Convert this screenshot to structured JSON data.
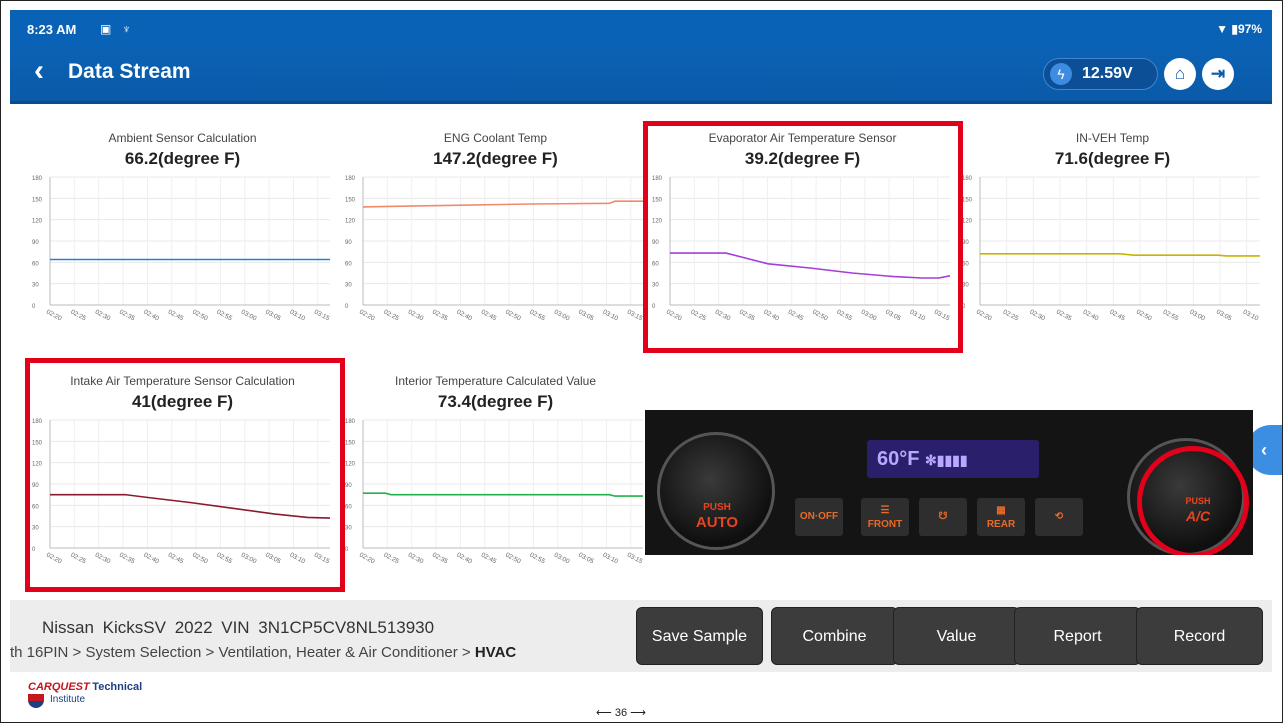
{
  "status": {
    "time": "8:23 AM",
    "battery": "97%"
  },
  "header": {
    "title": "Data Stream",
    "voltage": "12.59V"
  },
  "icons": {
    "back": "chevron-left-icon",
    "home": "home-icon",
    "exit": "exit-icon",
    "bolt": "lightning-icon"
  },
  "colors": {
    "header_blue": "#0a62b6",
    "highlight_red": "#e2001a",
    "ambient": "#2a7fd4",
    "coolant": "#f08a6a",
    "evaporator": "#a23fd8",
    "in_veh": "#c8b400",
    "intake": "#8a1a2e",
    "interior": "#22b14c"
  },
  "charts": {
    "ambient": {
      "label": "Ambient Sensor Calculation",
      "value": "66.2(degree F)"
    },
    "coolant": {
      "label": "ENG Coolant Temp",
      "value": "147.2(degree F)"
    },
    "evaporator": {
      "label": "Evaporator Air Temperature Sensor",
      "value": "39.2(degree F)"
    },
    "in_veh": {
      "label": "IN-VEH Temp",
      "value": "71.6(degree F)"
    },
    "intake": {
      "label": "Intake Air Temperature Sensor Calculation",
      "value": "41(degree F)"
    },
    "interior": {
      "label": "Interior Temperature Calculated Value",
      "value": "73.4(degree F)"
    }
  },
  "chart_data": [
    {
      "type": "line",
      "title": "Ambient Sensor Calculation",
      "ylim": [
        0,
        180
      ],
      "yticks": [
        "0",
        "30",
        "60",
        "90",
        "120",
        "150",
        "180"
      ],
      "xticks": [
        "02:20",
        "02:25",
        "02:30",
        "02:35",
        "02:40",
        "02:45",
        "02:50",
        "02:55",
        "03:00",
        "03:05",
        "03:10",
        "03:15"
      ],
      "series": [
        {
          "color": "#2a7fd4",
          "points": [
            [
              0,
              64
            ],
            [
              1,
              64
            ]
          ]
        }
      ]
    },
    {
      "type": "line",
      "title": "ENG Coolant Temp",
      "ylim": [
        0,
        180
      ],
      "yticks": [
        "0",
        "30",
        "60",
        "90",
        "120",
        "150",
        "180"
      ],
      "xticks": [
        "02:20",
        "02:25",
        "02:30",
        "02:35",
        "02:40",
        "02:45",
        "02:50",
        "02:55",
        "03:00",
        "03:05",
        "03:10",
        "03:15"
      ],
      "series": [
        {
          "color": "#f08a6a",
          "points": [
            [
              0,
              138
            ],
            [
              0.3,
              140
            ],
            [
              0.6,
              142
            ],
            [
              0.88,
              143
            ],
            [
              0.9,
              146
            ],
            [
              1,
              146
            ]
          ]
        }
      ]
    },
    {
      "type": "line",
      "title": "Evaporator Air Temperature Sensor",
      "ylim": [
        0,
        180
      ],
      "yticks": [
        "0",
        "30",
        "60",
        "90",
        "120",
        "150",
        "180"
      ],
      "xticks": [
        "02:20",
        "02:25",
        "02:30",
        "02:35",
        "02:40",
        "02:45",
        "02:50",
        "02:55",
        "03:00",
        "03:05",
        "03:10",
        "03:15"
      ],
      "series": [
        {
          "color": "#a23fd8",
          "points": [
            [
              0,
              73
            ],
            [
              0.2,
              73
            ],
            [
              0.25,
              68
            ],
            [
              0.35,
              58
            ],
            [
              0.5,
              52
            ],
            [
              0.65,
              45
            ],
            [
              0.8,
              40
            ],
            [
              0.9,
              38
            ],
            [
              0.96,
              38
            ],
            [
              1,
              41
            ]
          ]
        }
      ]
    },
    {
      "type": "line",
      "title": "IN-VEH Temp",
      "ylim": [
        0,
        180
      ],
      "yticks": [
        "0",
        "30",
        "60",
        "90",
        "120",
        "150",
        "180"
      ],
      "xticks": [
        "02:20",
        "02:25",
        "02:30",
        "02:35",
        "02:40",
        "02:45",
        "02:50",
        "02:55",
        "03:00",
        "03:05",
        "03:10"
      ],
      "series": [
        {
          "color": "#c8b400",
          "points": [
            [
              0,
              72
            ],
            [
              0.5,
              72
            ],
            [
              0.55,
              70
            ],
            [
              0.85,
              70
            ],
            [
              0.88,
              69
            ],
            [
              1,
              69
            ]
          ]
        }
      ]
    },
    {
      "type": "line",
      "title": "Intake Air Temperature Sensor Calculation",
      "ylim": [
        0,
        180
      ],
      "yticks": [
        "0",
        "30",
        "60",
        "90",
        "120",
        "150",
        "180"
      ],
      "xticks": [
        "02:20",
        "02:25",
        "02:30",
        "02:35",
        "02:40",
        "02:45",
        "02:50",
        "02:55",
        "03:00",
        "03:05",
        "03:10",
        "03:15"
      ],
      "series": [
        {
          "color": "#8a1a2e",
          "points": [
            [
              0,
              75
            ],
            [
              0.27,
              75
            ],
            [
              0.35,
              71
            ],
            [
              0.5,
              64
            ],
            [
              0.65,
              56
            ],
            [
              0.8,
              48
            ],
            [
              0.92,
              43
            ],
            [
              1,
              42
            ]
          ]
        }
      ]
    },
    {
      "type": "line",
      "title": "Interior Temperature Calculated Value",
      "ylim": [
        0,
        180
      ],
      "yticks": [
        "0",
        "30",
        "60",
        "90",
        "120",
        "150",
        "180"
      ],
      "xticks": [
        "02:20",
        "02:25",
        "02:30",
        "02:35",
        "02:40",
        "02:45",
        "02:50",
        "02:55",
        "03:00",
        "03:05",
        "03:10",
        "03:15"
      ],
      "series": [
        {
          "color": "#22b14c",
          "points": [
            [
              0,
              77
            ],
            [
              0.08,
              77
            ],
            [
              0.1,
              75
            ],
            [
              0.88,
              75
            ],
            [
              0.9,
              73
            ],
            [
              1,
              73
            ]
          ]
        }
      ]
    }
  ],
  "climate": {
    "lcd": "60°F",
    "push": "PUSH",
    "auto": "AUTO",
    "ac": "A/C",
    "onoff": "ON·OFF",
    "front": "FRONT",
    "rear": "REAR"
  },
  "footer": {
    "vehicle": "Nissan  KicksSV  2022  VIN  3N1CP5CV8NL513930",
    "path": "th 16PIN > System Selection > Ventilation, Heater & Air Conditioner > ",
    "path_end": "HVAC",
    "buttons": [
      "Save Sample",
      "Combine",
      "Value",
      "Report",
      "Record"
    ]
  },
  "logo": {
    "name": "CARQUEST",
    "tech": "Technical",
    "sub": "Institute"
  },
  "page": {
    "number": "36"
  }
}
